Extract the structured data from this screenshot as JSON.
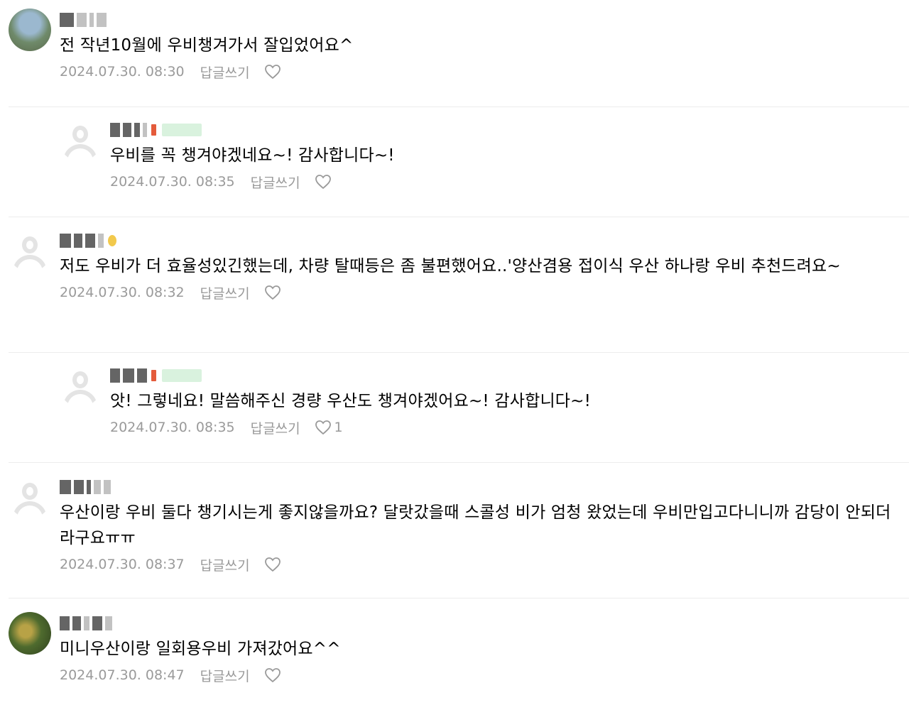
{
  "comments": [
    {
      "depth": 0,
      "avatar": "photo-sky",
      "text": "전 작년10월에 우비챙겨가서 잘입었어요^",
      "date": "2024.07.30. 08:30",
      "reply_label": "답글쓰기",
      "like_count": ""
    },
    {
      "depth": 1,
      "avatar": "default",
      "text": "우비를 꼭 챙겨야겠네요~! 감사합니다~!",
      "date": "2024.07.30. 08:35",
      "reply_label": "답글쓰기",
      "like_count": ""
    },
    {
      "depth": 0,
      "avatar": "default",
      "text": "저도 우비가 더 효율성있긴했는데, 차량 탈때등은 좀 불편했어요..'양산겸용 접이식 우산 하나랑 우비 추천드려요~",
      "date": "2024.07.30. 08:32",
      "reply_label": "답글쓰기",
      "like_count": ""
    },
    {
      "depth": 1,
      "avatar": "default",
      "text": "앗! 그렇네요! 말씀해주신 경량 우산도 챙겨야겠어요~! 감사합니다~!",
      "date": "2024.07.30. 08:35",
      "reply_label": "답글쓰기",
      "like_count": "1"
    },
    {
      "depth": 0,
      "avatar": "default",
      "text": "우산이랑 우비 둘다 챙기시는게 좋지않을까요? 달랏갔을때 스콜성 비가 엄청 왔었는데 우비만입고다니니까 감당이 안되더라구요ㅠㅠ",
      "date": "2024.07.30. 08:37",
      "reply_label": "답글쓰기",
      "like_count": ""
    },
    {
      "depth": 0,
      "avatar": "photo-green",
      "text": "미니우산이랑 일회용우비 가져갔어요^^",
      "date": "2024.07.30. 08:47",
      "reply_label": "답글쓰기",
      "like_count": ""
    }
  ],
  "icons": {
    "like": "heart-outline-icon",
    "avatar_default": "user-silhouette-icon"
  },
  "colors": {
    "meta_text": "#9a9a9a",
    "divider": "#ececec",
    "badge": "#d9f2de"
  }
}
